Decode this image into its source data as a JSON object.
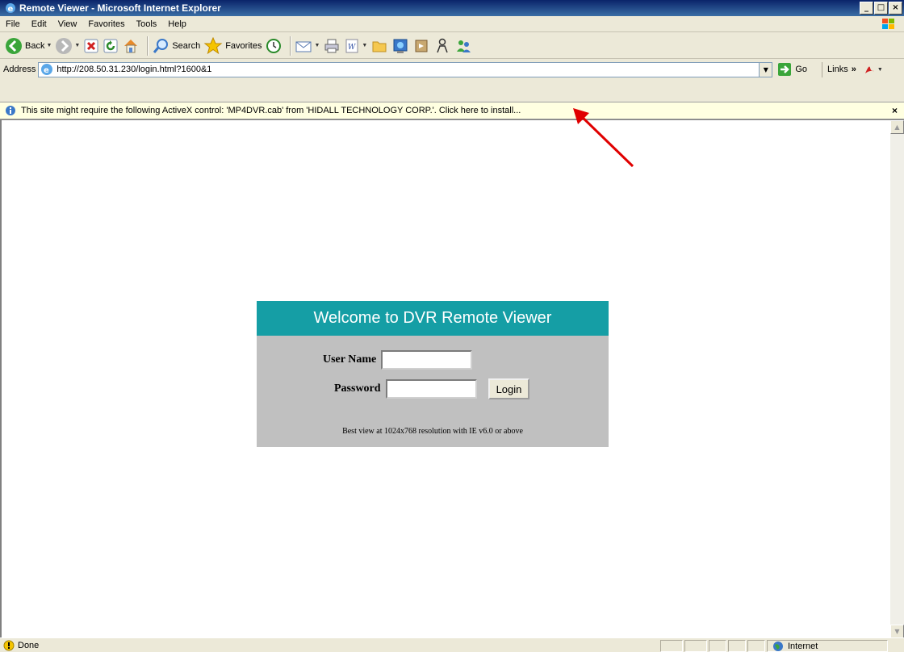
{
  "window": {
    "title": "Remote Viewer - Microsoft Internet Explorer",
    "minimize": "_",
    "maximize": "□",
    "close": "×"
  },
  "menu": [
    "File",
    "Edit",
    "View",
    "Favorites",
    "Tools",
    "Help"
  ],
  "toolbar": {
    "back_label": "Back",
    "search_label": "Search",
    "favorites_label": "Favorites"
  },
  "address": {
    "label": "Address",
    "url": "http://208.50.31.230/login.html?1600&1",
    "go_label": "Go",
    "links_label": "Links",
    "links_chevron": "»"
  },
  "infobar": {
    "message": "This site might require the following ActiveX control: 'MP4DVR.cab' from 'HIDALL TECHNOLOGY CORP.'. Click here to install...",
    "close": "×"
  },
  "login": {
    "title": "Welcome to DVR Remote Viewer",
    "username_label": "User Name",
    "password_label": "Password",
    "login_button": "Login",
    "hint": "Best view at 1024x768 resolution with IE v6.0 or above"
  },
  "status": {
    "text": "Done",
    "zone": "Internet"
  },
  "colors": {
    "login_header": "#159ea5",
    "login_body": "#c0c0c0",
    "infobar": "#ffffe1",
    "annotation_arrow": "#e00000"
  }
}
